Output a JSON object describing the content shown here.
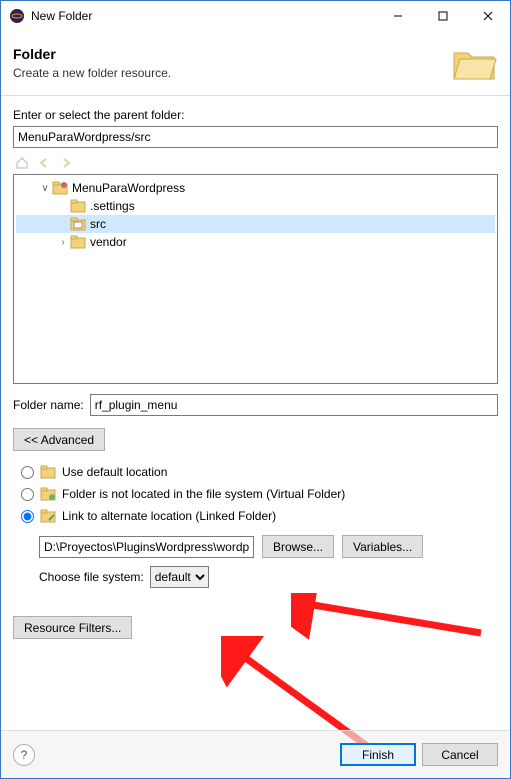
{
  "window": {
    "title": "New Folder"
  },
  "banner": {
    "heading": "Folder",
    "sub": "Create a new folder resource."
  },
  "parent": {
    "label": "Enter or select the parent folder:",
    "value": "MenuParaWordpress/src"
  },
  "tree": {
    "root": "MenuParaWordpress",
    "children": [
      {
        "label": ".settings",
        "expandable": false
      },
      {
        "label": "src",
        "selected": true,
        "expandable": false
      },
      {
        "label": "vendor",
        "expandable": true
      }
    ]
  },
  "folderName": {
    "label": "Folder name:",
    "value": "rf_plugin_menu"
  },
  "advancedBtn": "<<  Advanced",
  "options": {
    "o1": "Use default location",
    "o2": "Folder is not located in the file system (Virtual Folder)",
    "o3": "Link to alternate location (Linked Folder)"
  },
  "path": {
    "value": "D:\\Proyectos\\PluginsWordpress\\wordpress\\wp-",
    "browse": "Browse...",
    "vars": "Variables..."
  },
  "fs": {
    "label": "Choose file system:",
    "value": "default"
  },
  "filtersBtn": "Resource Filters...",
  "footer": {
    "finish": "Finish",
    "cancel": "Cancel"
  }
}
